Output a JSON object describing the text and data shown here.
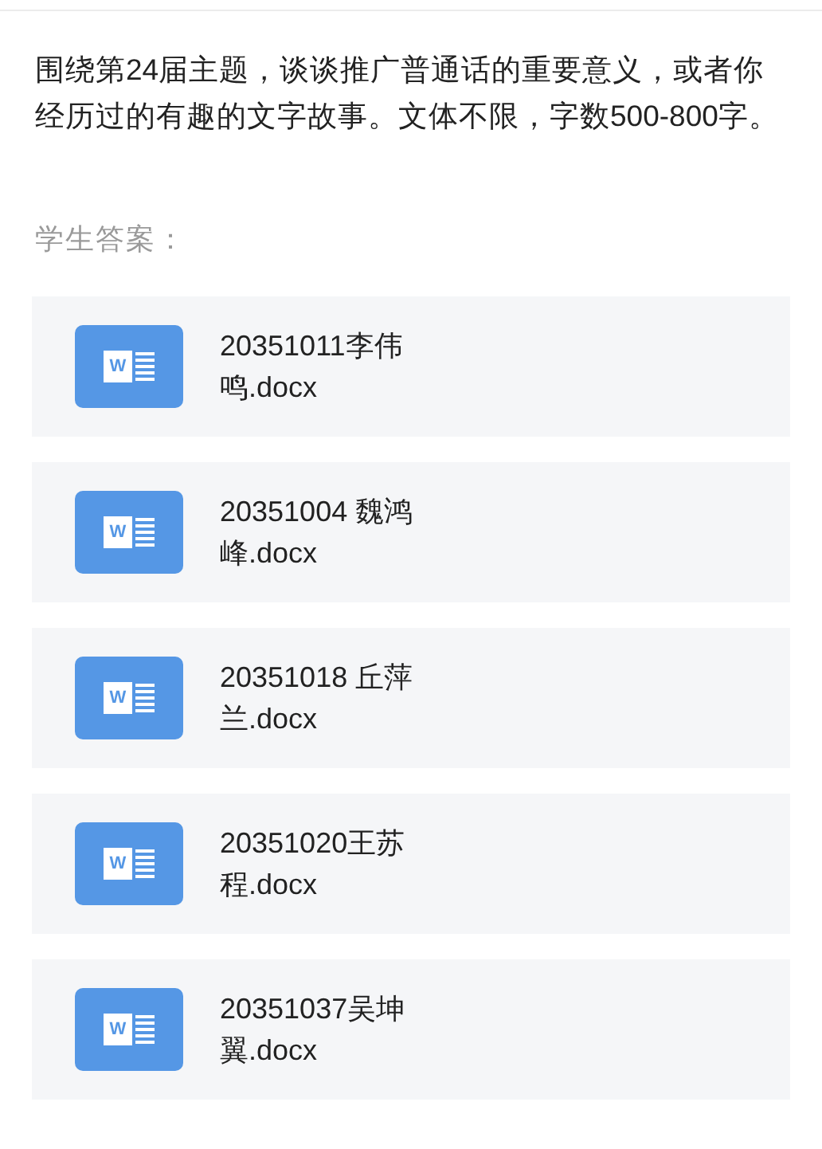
{
  "question": "围绕第24届主题，谈谈推广普通话的重要意义，或者你经历过的有趣的文字故事。文体不限，字数500-800字。",
  "answers_label": "学生答案：",
  "files": [
    {
      "icon_letter": "W",
      "name_lines": [
        "20351011李伟",
        "鸣.docx"
      ]
    },
    {
      "icon_letter": "W",
      "name_lines": [
        "20351004 魏鸿",
        "峰.docx"
      ]
    },
    {
      "icon_letter": "W",
      "name_lines": [
        "20351018 丘萍",
        "兰.docx"
      ]
    },
    {
      "icon_letter": "W",
      "name_lines": [
        "20351020王苏",
        "程.docx"
      ]
    },
    {
      "icon_letter": "W",
      "name_lines": [
        "20351037吴坤",
        "翼.docx"
      ]
    }
  ]
}
